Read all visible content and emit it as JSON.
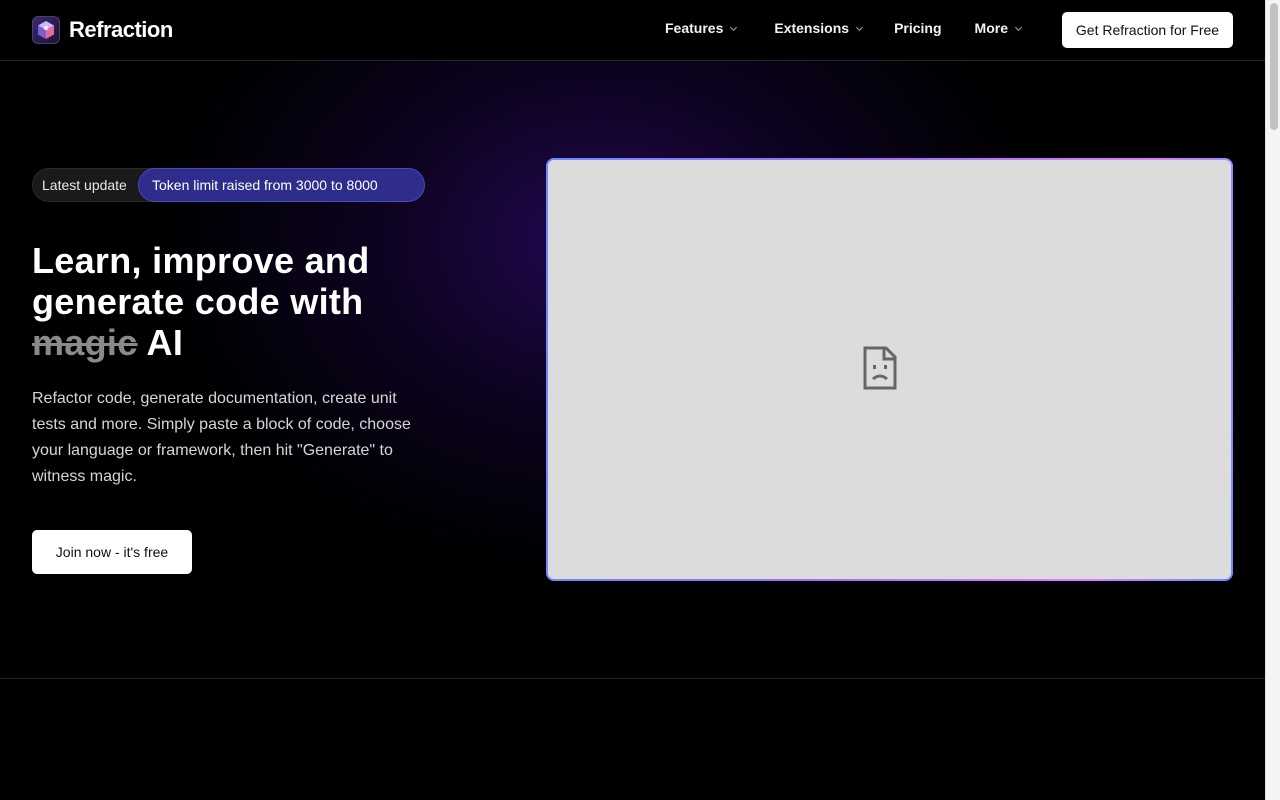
{
  "header": {
    "brand": "Refraction",
    "logo_icon": "refraction-cube-icon",
    "nav": [
      {
        "label": "Features",
        "has_dropdown": true
      },
      {
        "label": "Extensions",
        "has_dropdown": true
      },
      {
        "label": "Pricing",
        "has_dropdown": false
      },
      {
        "label": "More",
        "has_dropdown": true
      }
    ],
    "cta_label": "Get Refraction for Free"
  },
  "hero": {
    "badge_label": "Latest update",
    "badge_text": "Token limit raised from 3000 to 8000",
    "headline_line1": "Learn, improve and",
    "headline_line2": "generate code with",
    "headline_struck": "magic",
    "headline_end": "AI",
    "description": "Refactor code, generate documentation, create unit tests and more. Simply paste a block of code, choose your language or framework, then hit \"Generate\" to witness magic.",
    "cta_label": "Join now - it's free",
    "media_icon": "broken-image-icon"
  },
  "colors": {
    "background": "#000000",
    "badge_pill": "#2e2d8c",
    "accent_glow": "#300a6e",
    "media_placeholder": "#dcdcdc"
  }
}
